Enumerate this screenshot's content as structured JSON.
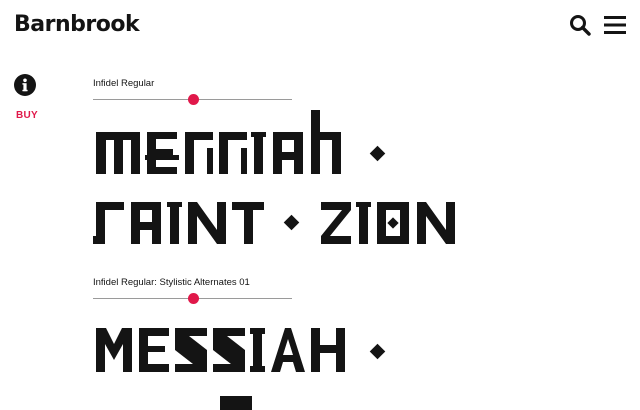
{
  "header": {
    "logo_text": "Barnbrook",
    "search_icon": "search-icon",
    "menu_icon": "hamburger-menu-icon"
  },
  "sidebar": {
    "info_icon": "info-icon",
    "buy_label": "BUY"
  },
  "specimens": [
    {
      "font_name": "Infidel Regular",
      "size_slider_value": 0.5,
      "sample_lines": [
        "MESSIAH ◆",
        "SAINT ◆ ZION"
      ]
    },
    {
      "font_name": "Infidel Regular: Stylistic Alternates 01",
      "size_slider_value": 0.5,
      "sample_lines": [
        "MESSIAH ◆",
        "T"
      ]
    }
  ],
  "colors": {
    "accent": "#e0184a",
    "text": "#141414",
    "background": "#ffffff",
    "slider_track": "#9a9a9a"
  }
}
